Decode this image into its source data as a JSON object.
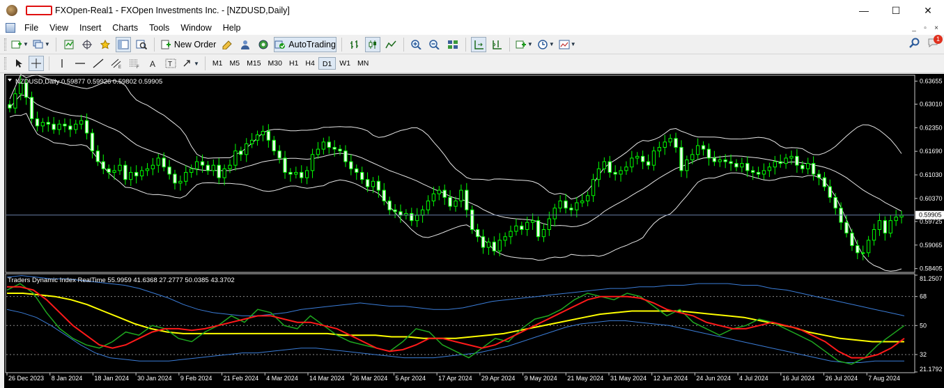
{
  "window": {
    "title": "FXOpen-Real1 - FXOpen Investments Inc. - [NZDUSD,Daily]",
    "controls": {
      "minimize": "—",
      "maximize": "☐",
      "close": "✕"
    }
  },
  "menu": {
    "items": [
      "File",
      "View",
      "Insert",
      "Charts",
      "Tools",
      "Window",
      "Help"
    ],
    "mdi": {
      "minimize": "_",
      "restore": "▫",
      "close": "×"
    }
  },
  "toolbar": {
    "new_order_label": "New Order",
    "autotrading_label": "AutoTrading",
    "notification_count": "1"
  },
  "timeframes": {
    "items": [
      "M1",
      "M5",
      "M15",
      "M30",
      "H1",
      "H4",
      "D1",
      "W1",
      "MN"
    ],
    "active": "D1"
  },
  "price_panel": {
    "header": "NZDUSD,Daily  0.59877 0.59926 0.59802 0.59905",
    "current_price": "0.59905",
    "price_levels": [
      "0.63655",
      "0.63010",
      "0.62350",
      "0.61690",
      "0.61030",
      "0.60370",
      "0.59725",
      "0.59065",
      "0.58405"
    ],
    "price_values": [
      0.63655,
      0.6301,
      0.6235,
      0.6169,
      0.6103,
      0.6037,
      0.59725,
      0.59065,
      0.58405
    ]
  },
  "indicator_panel": {
    "header": "Traders Dynamic Index RealTime 55.9959 41.6368 27.2777 50.0385 43.3702",
    "levels": [
      "81.2507",
      "68",
      "50",
      "32",
      "21.1792"
    ],
    "level_values": [
      81.2507,
      68,
      50,
      32,
      21.1792
    ]
  },
  "time_axis": {
    "labels": [
      "26 Dec 2023",
      "8 Jan 2024",
      "18 Jan 2024",
      "30 Jan 2024",
      "9 Feb 2024",
      "21 Feb 2024",
      "4 Mar 2024",
      "14 Mar 2024",
      "26 Mar 2024",
      "5 Apr 2024",
      "17 Apr 2024",
      "29 Apr 2024",
      "9 May 2024",
      "21 May 2024",
      "31 May 2024",
      "12 Jun 2024",
      "24 Jun 2024",
      "4 Jul 2024",
      "16 Jul 2024",
      "26 Jul 2024",
      "7 Aug 2024"
    ]
  },
  "chart_data": {
    "type": "candlestick",
    "symbol": "NZDUSD",
    "timeframe": "Daily",
    "ylim": [
      0.5832,
      0.638
    ],
    "close_series": [
      0.629,
      0.633,
      0.636,
      0.632,
      0.626,
      0.624,
      0.625,
      0.6245,
      0.623,
      0.6245,
      0.624,
      0.623,
      0.6245,
      0.6255,
      0.622,
      0.617,
      0.614,
      0.612,
      0.611,
      0.6115,
      0.613,
      0.609,
      0.611,
      0.61,
      0.6115,
      0.612,
      0.613,
      0.615,
      0.6125,
      0.6105,
      0.608,
      0.6085,
      0.611,
      0.612,
      0.614,
      0.613,
      0.6115,
      0.613,
      0.6095,
      0.612,
      0.613,
      0.617,
      0.616,
      0.619,
      0.62,
      0.6215,
      0.6225,
      0.62,
      0.617,
      0.615,
      0.611,
      0.6105,
      0.611,
      0.6095,
      0.6115,
      0.616,
      0.6175,
      0.6195,
      0.618,
      0.6175,
      0.617,
      0.614,
      0.612,
      0.611,
      0.609,
      0.607,
      0.6085,
      0.606,
      0.603,
      0.6005,
      0.6,
      0.599,
      0.5995,
      0.5975,
      0.599,
      0.6005,
      0.603,
      0.605,
      0.606,
      0.604,
      0.6015,
      0.603,
      0.606,
      0.6005,
      0.595,
      0.593,
      0.59,
      0.5915,
      0.589,
      0.592,
      0.593,
      0.5945,
      0.596,
      0.595,
      0.597,
      0.5975,
      0.593,
      0.595,
      0.598,
      0.601,
      0.603,
      0.601,
      0.6005,
      0.6025,
      0.603,
      0.6045,
      0.609,
      0.612,
      0.614,
      0.611,
      0.6105,
      0.6115,
      0.6125,
      0.615,
      0.6155,
      0.614,
      0.613,
      0.617,
      0.618,
      0.6195,
      0.6205,
      0.618,
      0.6115,
      0.6145,
      0.616,
      0.6185,
      0.6175,
      0.615,
      0.614,
      0.6145,
      0.614,
      0.6135,
      0.6125,
      0.6135,
      0.6115,
      0.611,
      0.6105,
      0.6115,
      0.6125,
      0.614,
      0.6135,
      0.615,
      0.6155,
      0.613,
      0.612,
      0.6135,
      0.6105,
      0.6095,
      0.607,
      0.604,
      0.601,
      0.597,
      0.594,
      0.5905,
      0.5885,
      0.5885,
      0.592,
      0.595,
      0.5975,
      0.594,
      0.5975,
      0.5985,
      0.599
    ],
    "indicator_series": [
      {
        "name": "Volatility Band Upper",
        "color": "#3b7dd8",
        "values": [
          80,
          81,
          80,
          79,
          79,
          78,
          77,
          76,
          75,
          73,
          70,
          67,
          63,
          60,
          58,
          57,
          56,
          56,
          57,
          58,
          60,
          61,
          62,
          63,
          64,
          63,
          62,
          62,
          61,
          60,
          60,
          61,
          63,
          65,
          66,
          67,
          68,
          69,
          70,
          71,
          72,
          73,
          73,
          74,
          74,
          75,
          75,
          76,
          76,
          76,
          75,
          75,
          73,
          72,
          70,
          68,
          66,
          64,
          62,
          60,
          58,
          56
        ]
      },
      {
        "name": "Volatility Band Lower",
        "color": "#3b7dd8",
        "values": [
          60,
          58,
          55,
          50,
          44,
          38,
          33,
          30,
          29,
          28,
          28,
          28,
          29,
          30,
          31,
          32,
          33,
          33,
          34,
          35,
          36,
          36,
          35,
          34,
          33,
          32,
          31,
          30,
          30,
          30,
          31,
          32,
          33,
          35,
          37,
          40,
          43,
          46,
          49,
          51,
          52,
          53,
          53,
          52,
          51,
          50,
          48,
          46,
          44,
          42,
          40,
          38,
          36,
          34,
          32,
          30,
          28,
          27,
          27,
          28,
          28,
          28
        ]
      },
      {
        "name": "Market Base Line",
        "color": "#ffff00",
        "values": [
          70,
          70,
          69,
          68,
          66,
          63,
          59,
          55,
          51,
          48,
          46,
          45,
          45,
          45,
          45,
          45,
          45,
          45,
          45,
          45,
          45,
          44,
          44,
          44,
          43,
          43,
          42,
          42,
          42,
          43,
          44,
          45,
          47,
          49,
          51,
          53,
          55,
          57,
          58,
          59,
          59,
          59,
          59,
          58,
          57,
          56,
          55,
          53,
          51,
          49,
          46,
          44,
          42,
          41,
          40,
          40,
          40
        ]
      },
      {
        "name": "RSI Price Line",
        "color": "#1fa81f",
        "values": [
          72,
          76,
          70,
          58,
          48,
          42,
          38,
          36,
          40,
          46,
          44,
          50,
          48,
          42,
          40,
          46,
          50,
          56,
          52,
          60,
          58,
          50,
          48,
          56,
          50,
          44,
          40,
          38,
          36,
          34,
          40,
          48,
          46,
          38,
          34,
          30,
          36,
          42,
          40,
          48,
          54,
          56,
          60,
          66,
          70,
          68,
          66,
          70,
          68,
          62,
          56,
          60,
          52,
          48,
          44,
          48,
          50,
          54,
          52,
          48,
          44,
          40,
          34,
          28,
          26,
          30,
          38,
          44,
          50
        ]
      },
      {
        "name": "Trade Signal Line",
        "color": "#ff1a1a",
        "values": [
          74,
          74,
          72,
          66,
          58,
          50,
          44,
          38,
          36,
          38,
          42,
          46,
          48,
          48,
          47,
          48,
          50,
          52,
          54,
          56,
          56,
          54,
          52,
          52,
          50,
          48,
          44,
          40,
          36,
          34,
          35,
          38,
          42,
          42,
          40,
          38,
          36,
          38,
          42,
          46,
          50,
          54,
          58,
          62,
          66,
          68,
          68,
          68,
          67,
          64,
          60,
          58,
          56,
          52,
          50,
          48,
          48,
          50,
          52,
          50,
          48,
          44,
          40,
          34,
          30,
          30,
          32,
          36,
          42
        ]
      }
    ],
    "indicator_ylim": [
      21.1792,
      81.2507
    ]
  }
}
